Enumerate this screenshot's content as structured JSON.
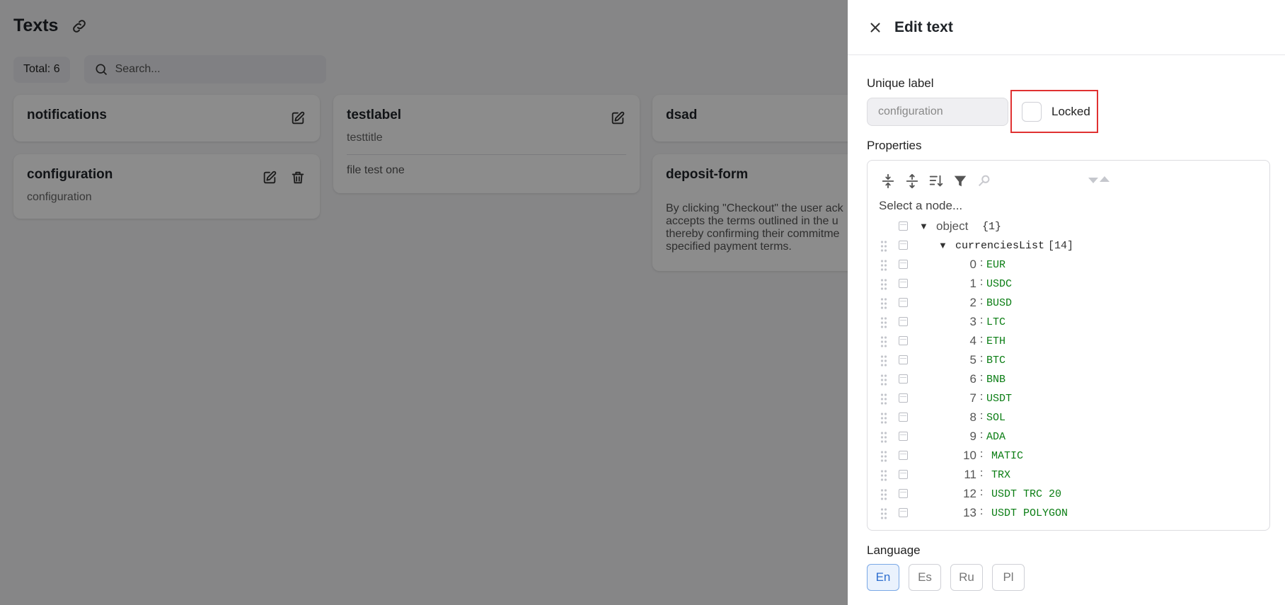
{
  "page": {
    "title": "Texts",
    "total_label": "Total: 6",
    "search_placeholder": "Search..."
  },
  "cards": [
    {
      "title": "notifications"
    },
    {
      "title": "testlabel",
      "subtitle": "testtitle",
      "body": "file test one"
    },
    {
      "title": "dsad"
    },
    {
      "title": "configuration",
      "subtitle": "configuration"
    },
    {
      "title": "deposit-form",
      "description": "By clicking \"Checkout\" the user ack\naccepts the terms outlined in the u\nthereby confirming their commitme\nspecified payment terms."
    }
  ],
  "drawer": {
    "title": "Edit text",
    "unique_label_heading": "Unique label",
    "unique_label_value": "configuration",
    "locked_label": "Locked",
    "properties_heading": "Properties",
    "select_node_placeholder": "Select a node...",
    "tree": {
      "root_key": "object",
      "root_count": "{1}",
      "list_key": "currenciesList",
      "list_count": "[14]",
      "items": [
        {
          "index": "0",
          "value": "EUR"
        },
        {
          "index": "1",
          "value": "USDC"
        },
        {
          "index": "2",
          "value": "BUSD"
        },
        {
          "index": "3",
          "value": "LTC"
        },
        {
          "index": "4",
          "value": "ETH"
        },
        {
          "index": "5",
          "value": "BTC"
        },
        {
          "index": "6",
          "value": "BNB"
        },
        {
          "index": "7",
          "value": "USDT"
        },
        {
          "index": "8",
          "value": "SOL"
        },
        {
          "index": "9",
          "value": "ADA"
        },
        {
          "index": "10",
          "value": "MATIC"
        },
        {
          "index": "11",
          "value": "TRX"
        },
        {
          "index": "12",
          "value": "USDT TRC 20"
        },
        {
          "index": "13",
          "value": "USDT POLYGON"
        }
      ]
    },
    "language_heading": "Language",
    "languages": [
      "En",
      "Es",
      "Ru",
      "Pl"
    ],
    "active_language": "En"
  },
  "colors": {
    "highlight_border": "#e03131",
    "value_green": "#0a7d13",
    "active_lang": "#2f6fd0"
  }
}
